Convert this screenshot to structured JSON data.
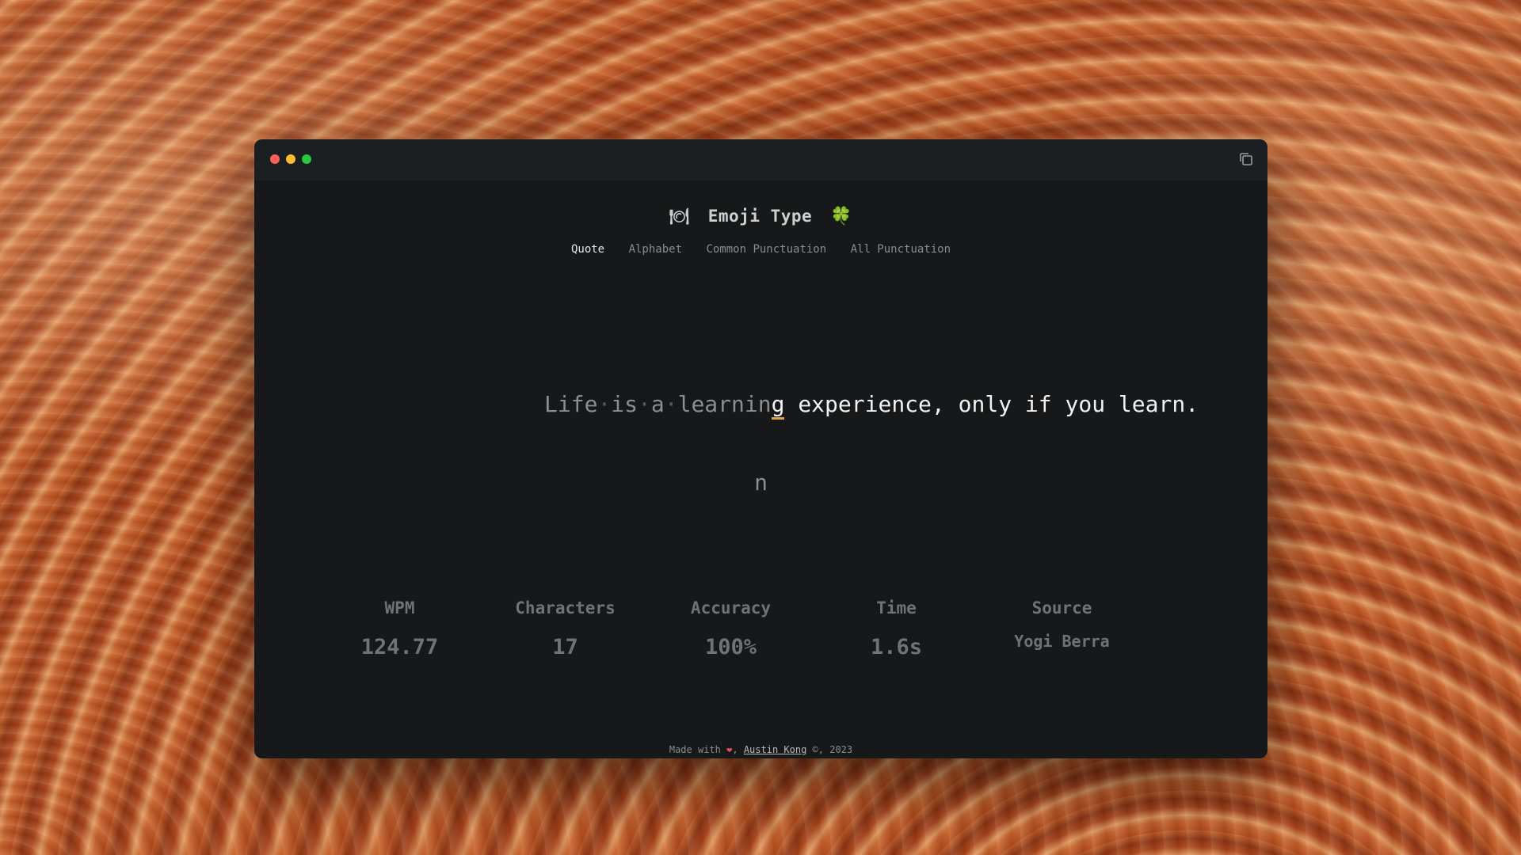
{
  "app": {
    "title": "Emoji Type",
    "left_emoji": "🍽",
    "right_emoji": "🍀",
    "accent_color": "#e0a24a"
  },
  "tabs": [
    {
      "label": "Quote",
      "active": true
    },
    {
      "label": "Alphabet",
      "active": false
    },
    {
      "label": "Common Punctuation",
      "active": false
    },
    {
      "label": "All Punctuation",
      "active": false
    }
  ],
  "quote": {
    "typed": [
      "Life",
      "is",
      "a",
      "learnin"
    ],
    "current_char": "g",
    "remaining": " experience, only if you learn.",
    "full_text": "Life is a learning experience, only if you learn."
  },
  "input": {
    "current_char": "n"
  },
  "stats": [
    {
      "label": "WPM",
      "value": "124.77"
    },
    {
      "label": "Characters",
      "value": "17"
    },
    {
      "label": "Accuracy",
      "value": "100%"
    },
    {
      "label": "Time",
      "value": "1.6s"
    },
    {
      "label": "Source",
      "value": "Yogi Berra"
    }
  ],
  "footer": {
    "prefix": "Made with",
    "heart": "❤",
    "comma": ",",
    "author_link": "Austin Kong",
    "suffix": "©, 2023"
  },
  "icons": {
    "window_close": "red-dot",
    "window_minimize": "yellow-dot",
    "window_maximize": "green-dot",
    "copy": "copy-icon"
  }
}
